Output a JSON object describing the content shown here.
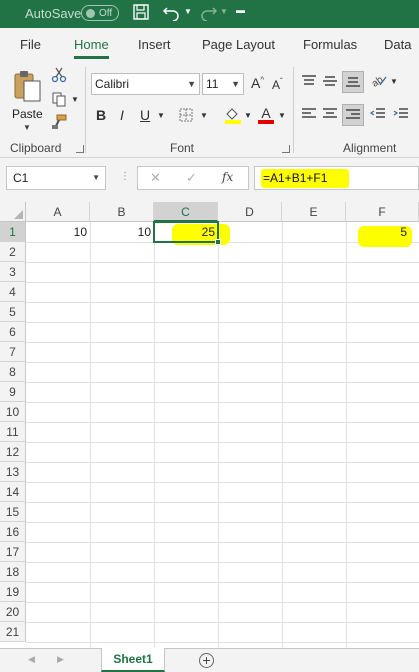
{
  "titlebar": {
    "autosave_label": "AutoSave",
    "autosave_state": "Off"
  },
  "ribbon_tabs": [
    "File",
    "Home",
    "Insert",
    "Page Layout",
    "Formulas",
    "Data"
  ],
  "active_tab": "Home",
  "ribbon": {
    "paste_label": "Paste",
    "font_name": "Calibri",
    "font_size": "11",
    "bold": "B",
    "italic": "I",
    "underline": "U",
    "grow_font": "A",
    "shrink_font": "A",
    "highlight_glyph": "A",
    "font_color_glyph": "A",
    "groups": {
      "clipboard": "Clipboard",
      "font": "Font",
      "alignment": "Alignment"
    }
  },
  "formula_bar": {
    "name_box": "C1",
    "cancel": "✕",
    "enter": "✓",
    "fx": "fx",
    "formula": "=A1+B1+F1"
  },
  "grid": {
    "columns": [
      "A",
      "B",
      "C",
      "D",
      "E",
      "F"
    ],
    "selected_column": "C",
    "rows": [
      "1",
      "2",
      "3",
      "4",
      "5",
      "6",
      "7",
      "8",
      "9",
      "10",
      "11",
      "12",
      "13",
      "14",
      "15",
      "16",
      "17",
      "18",
      "19",
      "20",
      "21"
    ],
    "selected_row": "1",
    "cells": {
      "A1": "10",
      "B1": "10",
      "C1": "25",
      "F1": "5"
    }
  },
  "sheets": {
    "tabs": [
      "Sheet1"
    ],
    "active": "Sheet1",
    "add_label": "+"
  },
  "colors": {
    "excel_green": "#217346",
    "highlight": "#ffff00"
  }
}
